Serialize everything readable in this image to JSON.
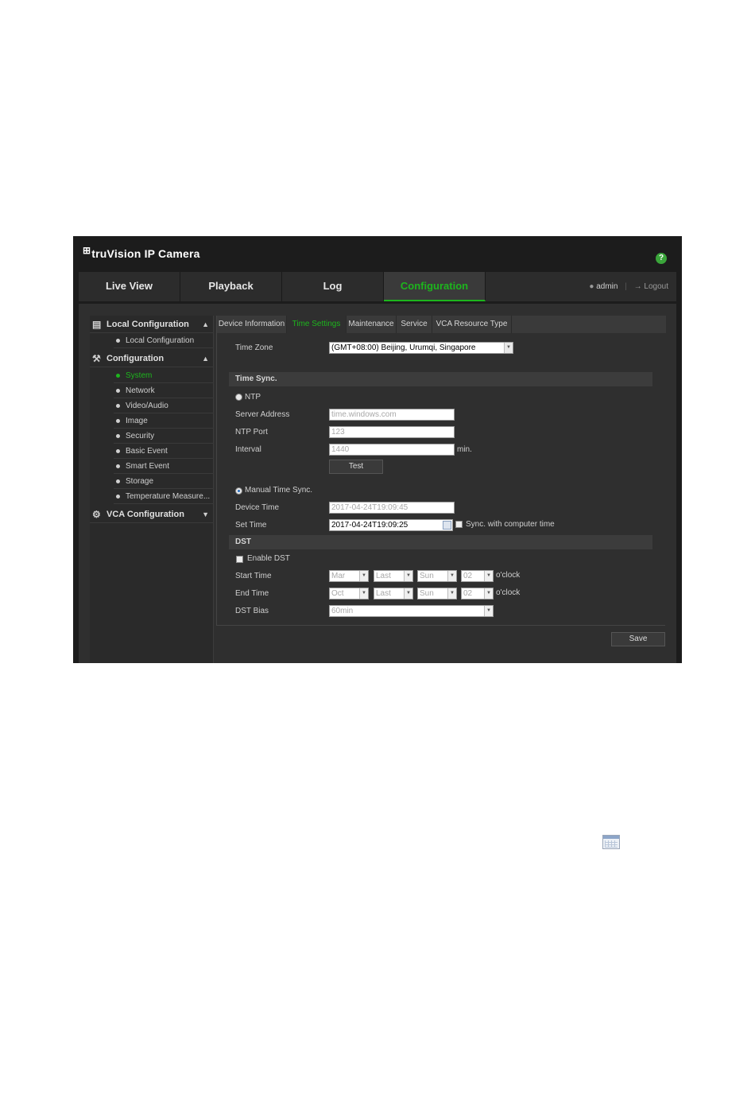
{
  "header": {
    "logo_glyph": "⊞",
    "brand": "truVision  IP Camera",
    "help": "?"
  },
  "nav": {
    "tabs": [
      {
        "label": "Live View"
      },
      {
        "label": "Playback"
      },
      {
        "label": "Log"
      },
      {
        "label": "Configuration",
        "active": true
      }
    ],
    "user": "admin",
    "logout": "Logout"
  },
  "sidebar": {
    "local_config": {
      "label": "Local Configuration",
      "items": [
        "Local Configuration"
      ]
    },
    "configuration": {
      "label": "Configuration",
      "items": [
        "System",
        "Network",
        "Video/Audio",
        "Image",
        "Security",
        "Basic Event",
        "Smart Event",
        "Storage",
        "Temperature Measure..."
      ],
      "active": "System"
    },
    "vca": {
      "label": "VCA Configuration"
    }
  },
  "tabs": [
    "Device Information",
    "Time Settings",
    "Maintenance",
    "Service",
    "VCA Resource Type"
  ],
  "active_tab": "Time Settings",
  "time_zone": {
    "label": "Time Zone",
    "value": "(GMT+08:00) Beijing, Urumqi, Singapore"
  },
  "time_sync": {
    "section": "Time Sync.",
    "ntp_label": "NTP",
    "server_label": "Server Address",
    "server_value": "time.windows.com",
    "port_label": "NTP Port",
    "port_value": "123",
    "interval_label": "Interval",
    "interval_value": "1440",
    "interval_unit": "min.",
    "test_label": "Test",
    "manual_label": "Manual Time Sync.",
    "device_time_label": "Device Time",
    "device_time_value": "2017-04-24T19:09:45",
    "set_time_label": "Set Time",
    "set_time_value": "2017-04-24T19:09:25",
    "sync_label": "Sync. with computer time"
  },
  "dst": {
    "section": "DST",
    "enable_label": "Enable DST",
    "start_label": "Start Time",
    "start": [
      "Mar",
      "Last",
      "Sun",
      "02"
    ],
    "end_label": "End Time",
    "end": [
      "Oct",
      "Last",
      "Sun",
      "02"
    ],
    "oclock": "o'clock",
    "bias_label": "DST Bias",
    "bias_value": "60min"
  },
  "save_label": "Save",
  "icons": {
    "help": "help-icon",
    "user": "user-icon",
    "logout": "logout-icon",
    "calendar": "calendar-icon"
  },
  "colors": {
    "accent": "#1db51d",
    "header_bg": "#1c1c1c",
    "panel_bg": "#2f2f2f"
  }
}
